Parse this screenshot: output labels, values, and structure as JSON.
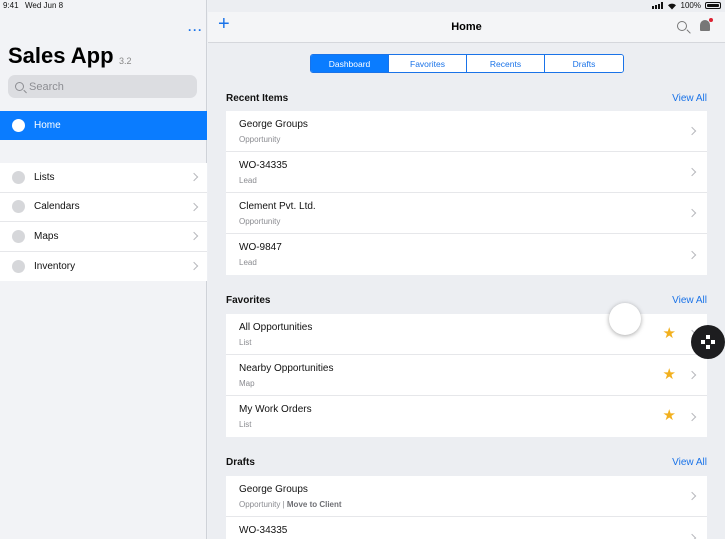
{
  "status_bar": {
    "time": "9:41",
    "date": "Wed Jun 8",
    "battery": "100%"
  },
  "sidebar": {
    "more_label": "···",
    "app_title": "Sales App",
    "version": "3.2",
    "search_placeholder": "Search",
    "active_item": {
      "label": "Home"
    },
    "items": [
      {
        "label": "Lists"
      },
      {
        "label": "Calendars"
      },
      {
        "label": "Maps"
      },
      {
        "label": "Inventory"
      }
    ]
  },
  "header": {
    "add_label": "+",
    "title": "Home"
  },
  "tabs": [
    {
      "label": "Dashboard",
      "active": true
    },
    {
      "label": "Favorites",
      "active": false
    },
    {
      "label": "Recents",
      "active": false
    },
    {
      "label": "Drafts",
      "active": false
    }
  ],
  "recent_items": {
    "title": "Recent Items",
    "view_all": "View All",
    "rows": [
      {
        "name": "George Groups",
        "type": "Opportunity"
      },
      {
        "name": "WO-34335",
        "type": "Lead"
      },
      {
        "name": "Clement Pvt. Ltd.",
        "type": "Opportunity"
      },
      {
        "name": "WO-9847",
        "type": "Lead"
      }
    ]
  },
  "favorites": {
    "title": "Favorites",
    "view_all": "View All",
    "rows": [
      {
        "name": "All Opportunities",
        "type": "List"
      },
      {
        "name": "Nearby Opportunities",
        "type": "Map"
      },
      {
        "name": "My Work Orders",
        "type": "List"
      }
    ]
  },
  "drafts": {
    "title": "Drafts",
    "view_all": "View All",
    "rows": [
      {
        "name": "George Groups",
        "type": "Opportunity",
        "separator": " | ",
        "action": "Move to Client"
      },
      {
        "name": "WO-34335",
        "type": ""
      }
    ]
  },
  "colors": {
    "accent": "#0a7cff",
    "link": "#1a73e8",
    "star": "#f2b01e"
  }
}
